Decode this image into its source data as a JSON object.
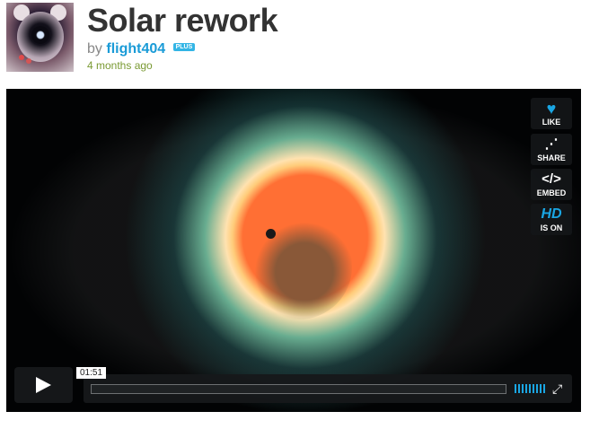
{
  "video": {
    "title": "Solar rework",
    "by_label": "by",
    "author": "flight404",
    "plus_badge": "PLUS",
    "age": "4 months ago"
  },
  "player": {
    "side_buttons": {
      "like": "LIKE",
      "share": "SHARE",
      "embed": "EMBED",
      "hd_glyph": "HD",
      "hd_label": "IS ON"
    },
    "timecode": "01:51"
  }
}
